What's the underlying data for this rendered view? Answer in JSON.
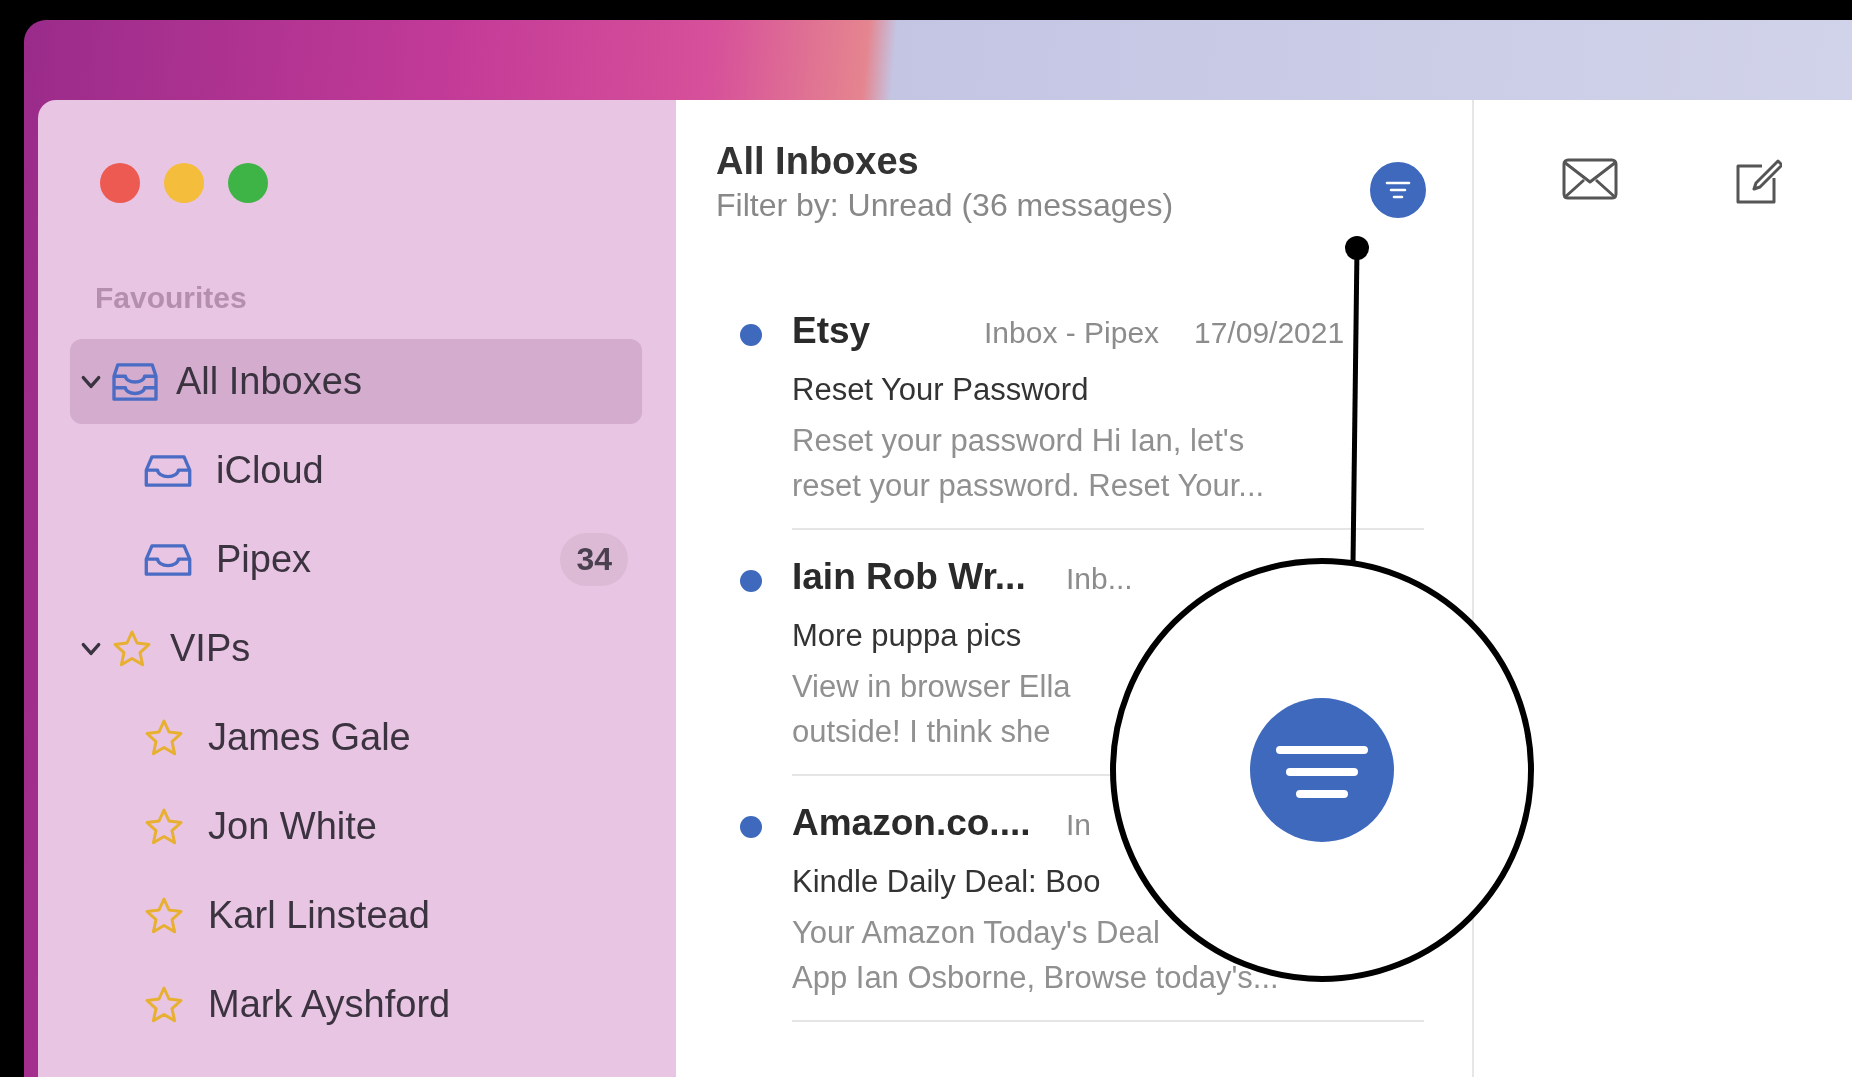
{
  "sidebar": {
    "section": "Favourites",
    "items": [
      {
        "kind": "all-inboxes",
        "label": "All Inboxes",
        "selected": true,
        "expanded": true,
        "children": [
          {
            "kind": "inbox",
            "label": "iCloud",
            "selected": false
          },
          {
            "kind": "inbox",
            "label": "Pipex",
            "selected": false,
            "badge": "34"
          }
        ]
      },
      {
        "kind": "vips",
        "label": "VIPs",
        "selected": false,
        "expanded": true,
        "children": [
          {
            "kind": "vip",
            "label": "James Gale",
            "selected": false
          },
          {
            "kind": "vip",
            "label": "Jon White",
            "selected": false
          },
          {
            "kind": "vip",
            "label": "Karl Linstead",
            "selected": false
          },
          {
            "kind": "vip",
            "label": "Mark Ayshford",
            "selected": false
          }
        ]
      }
    ]
  },
  "message_list": {
    "title": "All Inboxes",
    "filter_status": "Filter by: Unread (36 messages)",
    "filter_on": true,
    "messages": [
      {
        "unread": true,
        "sender": "Etsy",
        "mailbox": "Inbox - Pipex",
        "date": "17/09/2021",
        "subject": "Reset Your Password",
        "preview": [
          "Reset your password Hi Ian, let's",
          "reset your password. Reset Your..."
        ]
      },
      {
        "unread": true,
        "sender": "Iain Rob Wr...",
        "mailbox": "Inb...",
        "subject": "More puppa pics",
        "preview": [
          "View in browser Ella",
          "outside! I think she"
        ]
      },
      {
        "unread": true,
        "sender": "Amazon.co....",
        "mailbox": "In",
        "subject": "Kindle Daily Deal: Boo",
        "preview": [
          "Your Amazon Today's Deal",
          "App Ian Osborne, Browse today's..."
        ]
      }
    ]
  }
}
